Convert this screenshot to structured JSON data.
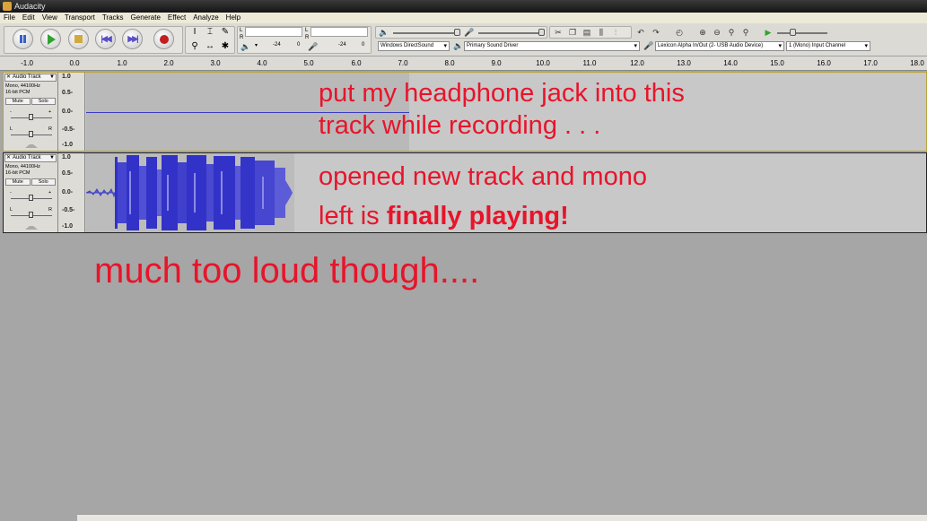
{
  "window": {
    "title": "Audacity"
  },
  "menu": [
    "File",
    "Edit",
    "View",
    "Transport",
    "Tracks",
    "Generate",
    "Effect",
    "Analyze",
    "Help"
  ],
  "transport_buttons": [
    "pause",
    "play",
    "stop",
    "skip-to-start",
    "skip-to-end",
    "record"
  ],
  "meter": {
    "left_label": "L",
    "right_label": "R",
    "rec_left": "L",
    "rec_right": "R",
    "ticks": [
      "-24",
      "0",
      "-24",
      "0"
    ]
  },
  "devices": {
    "host": "Windows DirectSound",
    "output": "Primary Sound Driver",
    "input": "Lexicon Alpha In/Out (2- USB Audio Device)",
    "channels": "1 (Mono) Input Channel"
  },
  "ruler": [
    "-1.0",
    "0.0",
    "1.0",
    "2.0",
    "3.0",
    "4.0",
    "5.0",
    "6.0",
    "7.0",
    "8.0",
    "9.0",
    "10.0",
    "11.0",
    "12.0",
    "13.0",
    "14.0",
    "15.0",
    "16.0",
    "17.0",
    "18.0"
  ],
  "tracks": [
    {
      "name": "Audio Track",
      "format1": "Mono, 44100Hz",
      "format2": "16-bit PCM",
      "mute": "Mute",
      "solo": "Solo",
      "gain_minus": "-",
      "gain_plus": "+",
      "pan_l": "L",
      "pan_r": "R",
      "scale": [
        "1.0",
        "0.5-",
        "0.0-",
        "-0.5-",
        "-1.0"
      ],
      "close": "✕",
      "menu": "▼"
    },
    {
      "name": "Audio Track",
      "format1": "Mono, 44100Hz",
      "format2": "16-bit PCM",
      "mute": "Mute",
      "solo": "Solo",
      "gain_minus": "-",
      "gain_plus": "+",
      "pan_l": "L",
      "pan_r": "R",
      "scale": [
        "1.0",
        "0.5-",
        "0.0-",
        "-0.5-",
        "-1.0"
      ],
      "close": "✕",
      "menu": "▼"
    }
  ],
  "annotations": {
    "a1_line1": "put my headphone jack into this",
    "a1_line2": "track while recording . . .",
    "a2_line1": "opened new track and mono",
    "a2_line2_prefix": "left is ",
    "a2_line2_bold": "finally playing!",
    "a3": "much too loud though...."
  },
  "colors": {
    "annotation": "#e8142a",
    "waveform": "#3232c8",
    "waveform_light": "#6464dc"
  }
}
